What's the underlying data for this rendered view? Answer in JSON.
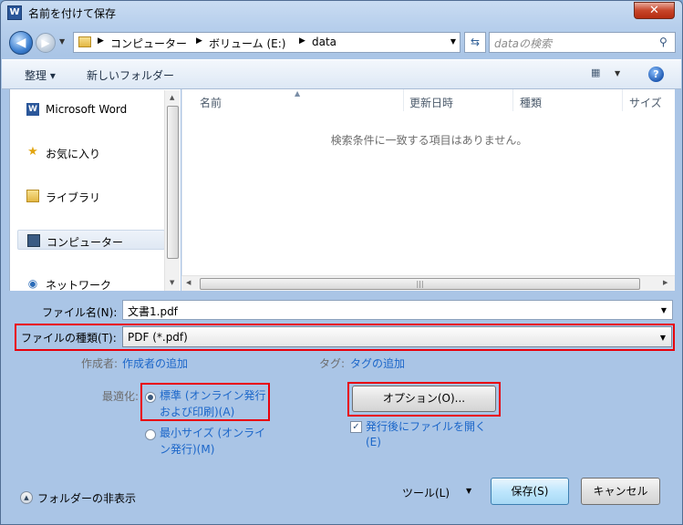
{
  "window": {
    "title": "名前を付けて保存",
    "app_icon": "W",
    "close": "✕"
  },
  "address": {
    "crumbs": [
      "コンピューター",
      "ボリューム (E:)",
      "data"
    ],
    "search_placeholder": "dataの検索"
  },
  "toolbar": {
    "organize": "整理 ▾",
    "new_folder": "新しいフォルダー",
    "help": "?"
  },
  "nav": {
    "items": [
      {
        "label": "Microsoft Word",
        "icon": "word-icon"
      },
      {
        "label": "お気に入り",
        "icon": "star-icon"
      },
      {
        "label": "ライブラリ",
        "icon": "library-icon"
      },
      {
        "label": "コンピューター",
        "icon": "computer-icon"
      },
      {
        "label": "ネットワーク",
        "icon": "network-icon"
      }
    ]
  },
  "files": {
    "columns": [
      "名前",
      "更新日時",
      "種類",
      "サイズ"
    ],
    "empty_message": "検索条件に一致する項目はありません。"
  },
  "form": {
    "filename_label": "ファイル名(N):",
    "filename_value": "文書1.pdf",
    "filetype_label": "ファイルの種類(T):",
    "filetype_value": "PDF (*.pdf)",
    "author_label": "作成者:",
    "author_link": "作成者の追加",
    "tags_label": "タグ:",
    "tags_link": "タグの追加",
    "optimize_label": "最適化:",
    "opt_standard_line1": "標準 (オンライン発行",
    "opt_standard_line2": "および印刷)(A)",
    "opt_min_line1": "最小サイズ (オンライ",
    "opt_min_line2": "ン発行)(M)",
    "options_button": "オプション(O)...",
    "open_after_line1": "発行後にファイルを開く",
    "open_after_line2": "(E)"
  },
  "footer": {
    "hide_folders": "フォルダーの非表示",
    "tools": "ツール(L)",
    "save": "保存(S)",
    "cancel": "キャンセル"
  },
  "state": {
    "optimize_selected": "standard",
    "open_after_checked": true
  }
}
